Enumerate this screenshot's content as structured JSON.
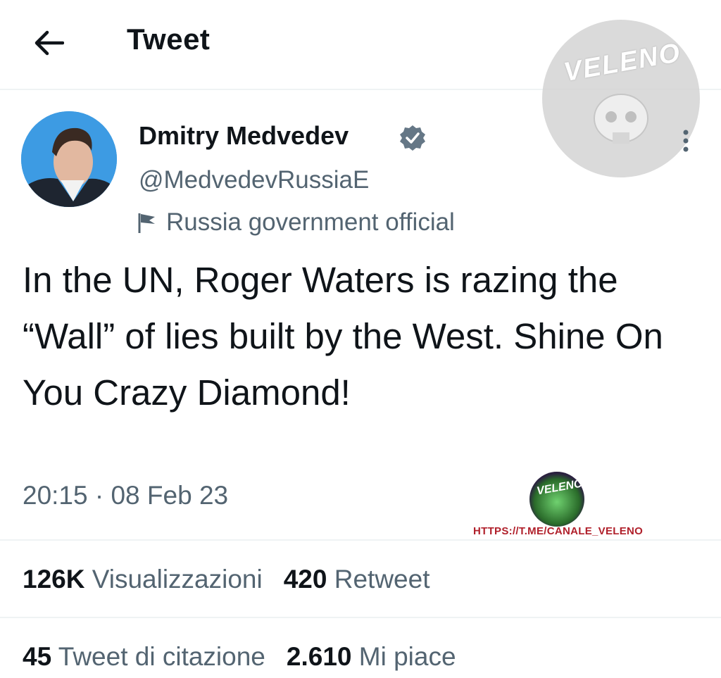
{
  "header": {
    "title": "Tweet"
  },
  "author": {
    "name": "Dmitry Medvedev",
    "handle": "@MedvedevRussiaE",
    "affiliation": "Russia government official"
  },
  "tweet": {
    "text": "In the UN, Roger Waters is razing the “Wall” of lies built by the West. Shine On You Crazy Diamond!",
    "timestamp": "20:15 · 08 Feb 23"
  },
  "stats": {
    "views_count": "126K",
    "views_label": "Visualizzazioni",
    "retweets_count": "420",
    "retweets_label": "Retweet",
    "quotes_count": "45",
    "quotes_label": "Tweet di citazione",
    "likes_count": "2.610",
    "likes_label": "Mi piace"
  },
  "watermark": {
    "logo_text": "VELENO",
    "channel_link": "HTTPS://T.ME/CANALE_VELENO"
  },
  "colors": {
    "verified_badge": "#657786",
    "secondary_text": "#536471",
    "channel_link": "#b0202b"
  },
  "icons": [
    "back-arrow-icon",
    "verified-badge-icon",
    "government-flag-icon",
    "more-options-icon"
  ]
}
